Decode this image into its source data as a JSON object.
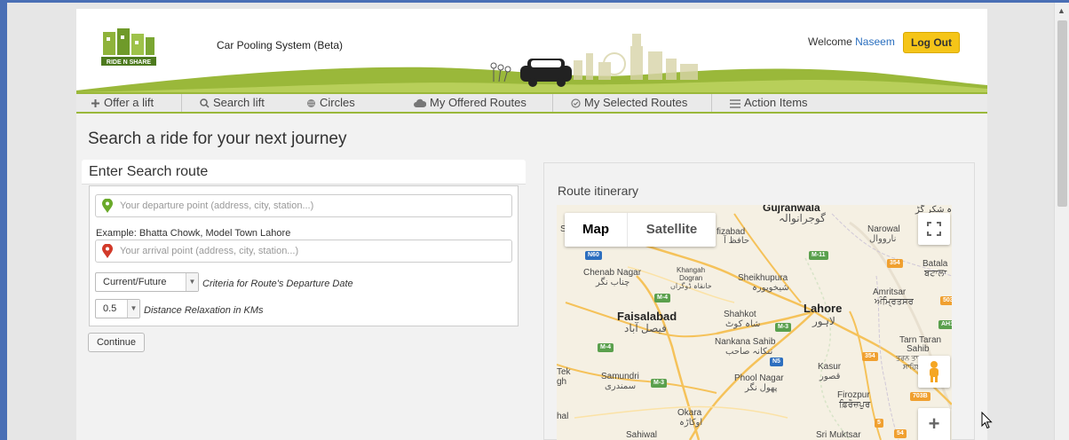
{
  "header": {
    "app_title": "Car Pooling System (Beta)",
    "welcome_prefix": "Welcome",
    "user_name": "Naseem",
    "logout_label": "Log Out",
    "logo_text": "RIDE N SHARE"
  },
  "nav": {
    "items": [
      {
        "label": "Offer a lift",
        "icon": "plus-icon"
      },
      {
        "label": "Search lift",
        "icon": "search-icon"
      },
      {
        "label": "Circles",
        "icon": "globe-icon"
      },
      {
        "label": "My Offered Routes",
        "icon": "cloud-icon"
      },
      {
        "label": "My Selected Routes",
        "icon": "check-circle-icon"
      },
      {
        "label": "Action Items",
        "icon": "list-icon"
      }
    ]
  },
  "page": {
    "heading": "Search a ride for your next journey"
  },
  "search": {
    "title": "Enter Search route",
    "departure_placeholder": "Your departure point (address, city, station...)",
    "example": "Example: Bhatta Chowk, Model Town Lahore",
    "arrival_placeholder": "Your arrival point (address, city, station...)",
    "date_criteria_value": "Current/Future",
    "date_criteria_caption": "Criteria for Route's Departure Date",
    "distance_value": "0.5",
    "distance_caption": "Distance Relaxation in KMs",
    "continue_label": "Continue"
  },
  "route": {
    "title": "Route itinerary",
    "map_type": {
      "map": "Map",
      "satellite": "Satellite"
    },
    "zoom_in": "+",
    "places": {
      "gujranwala": "Gujranwala",
      "gujranwala_ur": "گوجرانوالہ",
      "hafizabad": "fizabad",
      "hafizabad_ur": "حافظ آ",
      "narowal": "Narowal",
      "narowal_ur": "نارووال",
      "chenab_nagar": "Chenab Nagar",
      "chenab_nagar_ur": "چناب نگر",
      "khangah": "Khangah",
      "khangah2": "Dogran",
      "khangah_ur": "خانقاہ ڈوگراں",
      "sheikhupura": "Sheikhupura",
      "sheikhupura_ur": "شیخوپورہ",
      "batala": "Batala",
      "batala_pa": "ਬਟਾਲਾ",
      "amritsar": "Amritsar",
      "amritsar_pa": "ਅੰਮ੍ਰਿਤਸਰ",
      "faisalabad": "Faisalabad",
      "faisalabad_ur": "فیصل آباد",
      "shahkot": "Shahkot",
      "shahkot_ur": "شاہ کوٹ",
      "lahore": "Lahore",
      "lahore_ur": "لاہور",
      "nankana": "Nankana Sahib",
      "nankana_ur": "ننکانہ صاحب",
      "tarn_taran": "Tarn Taran",
      "tarn_taran2": "Sahib",
      "tarn_taran_pa": "ਤਰਨ ਤਾਰਨ",
      "tarn_taran_pa2": "ਸਾਹਿਬ",
      "kasur": "Kasur",
      "kasur_ur": "قصور",
      "samundri": "Samundri",
      "samundri_ur": "سمندری",
      "phool_nagar": "Phool Nagar",
      "phool_nagar_ur": "پھول نگر",
      "firozpur": "Firozpur",
      "firozpur_pa": "ਫ਼ਿਰੋਜ਼ਪੁਰ",
      "okara": "Okara",
      "okara_ur": "اوکاڑہ",
      "sahiwal": "Sahiwal",
      "sri_muktsar": "Sri Muktsar",
      "tek": "Tek",
      "gh": "gh",
      "hal": "hal",
      "edge_s": "S",
      "edge_top_right": "ہ شکر گڑ"
    },
    "shields": [
      "N60",
      "M-11",
      "M-4",
      "M-3",
      "N5",
      "M-4",
      "M-3",
      "354",
      "503",
      "AH1",
      "354",
      "703B",
      "5",
      "54"
    ]
  }
}
